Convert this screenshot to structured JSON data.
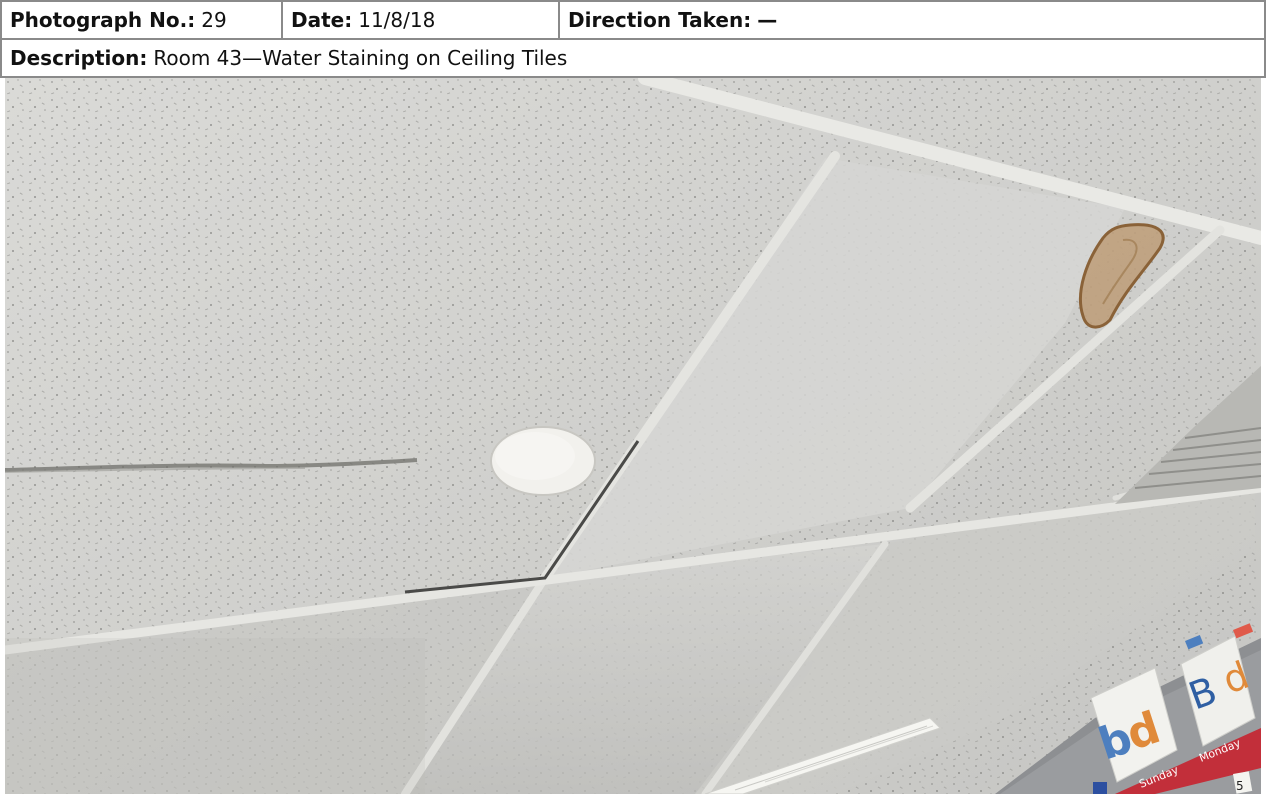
{
  "header": {
    "photo_no_label": "Photograph No.:",
    "photo_no_value": "29",
    "date_label": "Date:",
    "date_value": "11/8/18",
    "direction_label": "Direction Taken:",
    "direction_value": "—"
  },
  "description": {
    "label": "Description:",
    "value": "Room 43—Water Staining on Ceiling Tiles"
  },
  "photo": {
    "subject": "ceiling-tiles-water-stain",
    "classroom_card_letters": [
      "b",
      "d",
      "B",
      "d"
    ],
    "calendar_labels": [
      "Sunday",
      "Monday"
    ],
    "calendar_digit": "5",
    "colors": {
      "tile": "#d9d9d6",
      "tile_shadow": "#c3c3c0",
      "grid": "#ecece8",
      "stain": "#a27c52",
      "fixture": "#f4f3ef"
    }
  }
}
